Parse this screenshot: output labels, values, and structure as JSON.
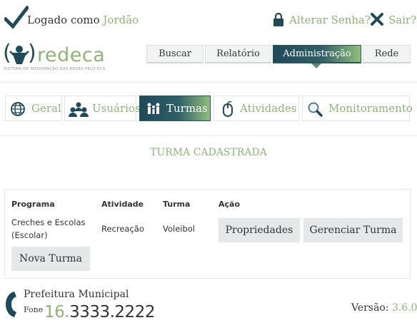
{
  "topbar": {
    "logged_prefix": "Logado como",
    "user": "Jordão",
    "change_password": "Alterar Senha?",
    "logout": "Sair?"
  },
  "logo": {
    "wordmark": "redeca",
    "tagline": "SISTEMA DE INFORMAÇÃO DAS REDES PELO ECA"
  },
  "nav": {
    "items": [
      {
        "label": "Buscar"
      },
      {
        "label": "Relatório"
      },
      {
        "label": "Administração",
        "active": true
      },
      {
        "label": "Rede"
      }
    ]
  },
  "tabs": [
    {
      "label": "Geral",
      "icon": "globe-icon"
    },
    {
      "label": "Usuários",
      "icon": "users-icon"
    },
    {
      "label": "Turmas",
      "icon": "family-icon",
      "active": true
    },
    {
      "label": "Atividades",
      "icon": "mouse-icon"
    },
    {
      "label": "Monitoramento",
      "icon": "magnifier-icon"
    }
  ],
  "page": {
    "heading": "TURMA CADASTRADA"
  },
  "table": {
    "headers": [
      "Programa",
      "Atividade",
      "Turma",
      "Ação"
    ],
    "row": {
      "programa": "Creches e Escolas (Escolar)",
      "atividade": "Recreação",
      "turma": "Voleibol"
    },
    "actions": {
      "properties": "Propriedades",
      "manage": "Gerenciar Turma"
    },
    "new_button": "Nova Turma"
  },
  "footer": {
    "prefeitura": "Prefeitura Municipal",
    "fone_label": "Fone",
    "fone_prefix": "16.",
    "fone_number": "3333.2222",
    "version_label": "Versão:",
    "version": "3.6.0"
  },
  "colors": {
    "accent_green": "#8bb674",
    "dark_teal": "#1f4a59"
  }
}
